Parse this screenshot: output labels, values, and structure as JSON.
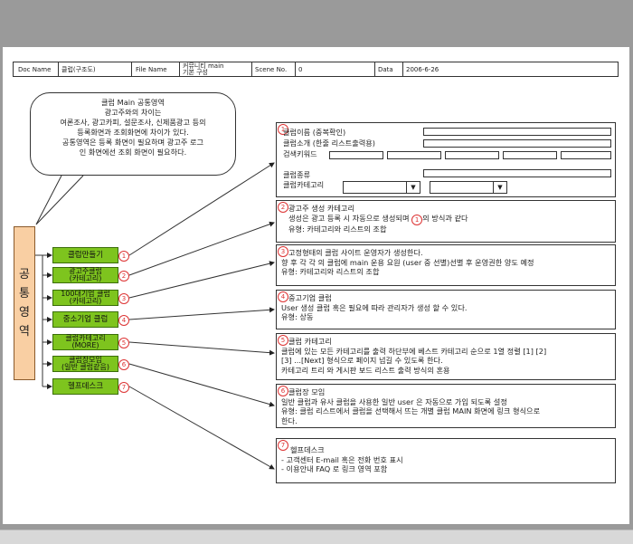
{
  "header": {
    "doc_name_label": "Doc Name",
    "doc_name_value": "클럽(구조도)",
    "file_name_label": "File Name",
    "file_name_value_line1": "커뮤니티 main",
    "file_name_value_line2": "기본 구성",
    "scene_no_label": "Scene No.",
    "scene_no_value": "0",
    "date_label": "Data",
    "date_value": "2006-6-26"
  },
  "callout": {
    "lines": [
      "클럽 Main 공통영역",
      "광고주와의 차이는",
      "여론조사, 광고카피, 설문조사, 신제품광고 등의",
      "등록화면과 조회화면에 차이가 있다.",
      "공통영역은 등록 화면이 필요하며 광고주 로그",
      "인 화면에선 조회 화면이 필요하다."
    ]
  },
  "vertical_label": [
    "공",
    "통",
    "영",
    "역"
  ],
  "menu": [
    {
      "num": "1",
      "line1": "클럽만들기",
      "line2": ""
    },
    {
      "num": "2",
      "line1": "광고주클럽",
      "line2": "(카테고리)"
    },
    {
      "num": "3",
      "line1": "100대기업 클럽",
      "line2": "(카테고리)"
    },
    {
      "num": "4",
      "line1": "중소기업 클럽",
      "line2": ""
    },
    {
      "num": "5",
      "line1": "클럽카테고리",
      "line2": "(MORE)"
    },
    {
      "num": "6",
      "line1": "클럽장모임",
      "line2": "(일반 클럽같음)"
    },
    {
      "num": "7",
      "line1": "헬프데스크",
      "line2": ""
    }
  ],
  "box1": {
    "num": "1",
    "club_name": "클럽이름 (중복확인)",
    "club_intro": "클럽소개 (한줄 리스트출력용)",
    "search_keyword": "검색키워드",
    "club_type": "클럽종류",
    "club_category": "클럽카테고리",
    "dropdown_arrow": "▼"
  },
  "box2": {
    "num": "2",
    "title": "광고주 생성 카테고리",
    "line1_a": "생성은 광고 등록 시 자동으로 생성되며",
    "line1_num": "1",
    "line1_b": "의 방식과 같다",
    "line2": "유형: 카테고리와 리스트의 조합"
  },
  "box3": {
    "num": "3",
    "line1": "고정형태의 클럽 사이트 운영자가 생성한다.",
    "line2": "향 후 각 각 의 클럽에 main 운용 요원 (user 중 선별)선별 후 운영권한 양도 예정",
    "line3": "유형: 카테고리와 리스트의 조합"
  },
  "box4": {
    "num": "4",
    "line1": "중고기업 클럽",
    "line2": "User 생성 클럽 혹은 필요에 따라 관리자가 생성 할 수 있다.",
    "line3": "유형: 상동"
  },
  "box5": {
    "num": "5",
    "line1": "클럽 카테고리",
    "line2": "클럽에 있는 모든 카테고리를 출력 하단부에 베스트 카테고리 순으로 1열 정렬 [1] [2]",
    "line3": "[3] ...[Next] 형식으로 페이지 넘길 수 있도록 한다.",
    "line4": "카테고리 트리 와 게시판 보드 리스트 출력 방식의 혼용"
  },
  "box6": {
    "num": "6",
    "line1": "클럽장 모임",
    "line2": "일반 클럽과 유사 클럽을 사용한 일반 user 은 자동으로 가입 되도록 설정",
    "line3": "유형: 클럽 리스트에서 클럽을 선택해서 뜨는 개별 클럽 MAIN 화면에 링크 형식으로",
    "line4": "한다."
  },
  "box7": {
    "num": "7",
    "line1": "헬프데스크",
    "line2": "- 고객센터 E-mail 혹은 전화 번호 표시",
    "line3": "- 이용안내 FAQ 로 링크 영역 포함"
  },
  "colors": {
    "menu_green": "#7ec41e",
    "vertical_bar": "#f9cfa3",
    "circle_red": "#d33"
  }
}
